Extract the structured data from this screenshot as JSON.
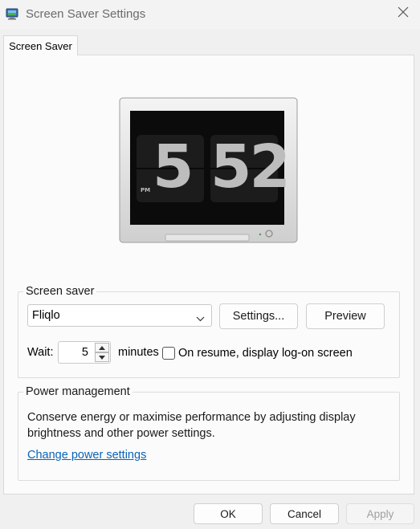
{
  "window": {
    "title": "Screen Saver Settings",
    "app_icon": "monitor-icon",
    "close_icon": "close-icon"
  },
  "tabs": [
    {
      "label": "Screen Saver",
      "active": true
    }
  ],
  "preview": {
    "clock_hour": "5",
    "clock_minute": "52",
    "clock_period": "PM"
  },
  "screen_saver": {
    "group_label": "Screen saver",
    "selected": "Fliqlo",
    "settings_label": "Settings...",
    "preview_label": "Preview",
    "wait_label": "Wait:",
    "wait_value": "5",
    "minutes_label": "minutes",
    "resume_label": "On resume, display log-on screen",
    "resume_checked": false
  },
  "power": {
    "group_label": "Power management",
    "description": "Conserve energy or maximise performance by adjusting display brightness and other power settings.",
    "link_label": "Change power settings"
  },
  "footer": {
    "ok_label": "OK",
    "cancel_label": "Cancel",
    "apply_label": "Apply",
    "apply_enabled": false
  },
  "colors": {
    "link": "#0a63b9",
    "panel_bg": "#fbfbfb",
    "window_bg": "#f0f0f0"
  }
}
